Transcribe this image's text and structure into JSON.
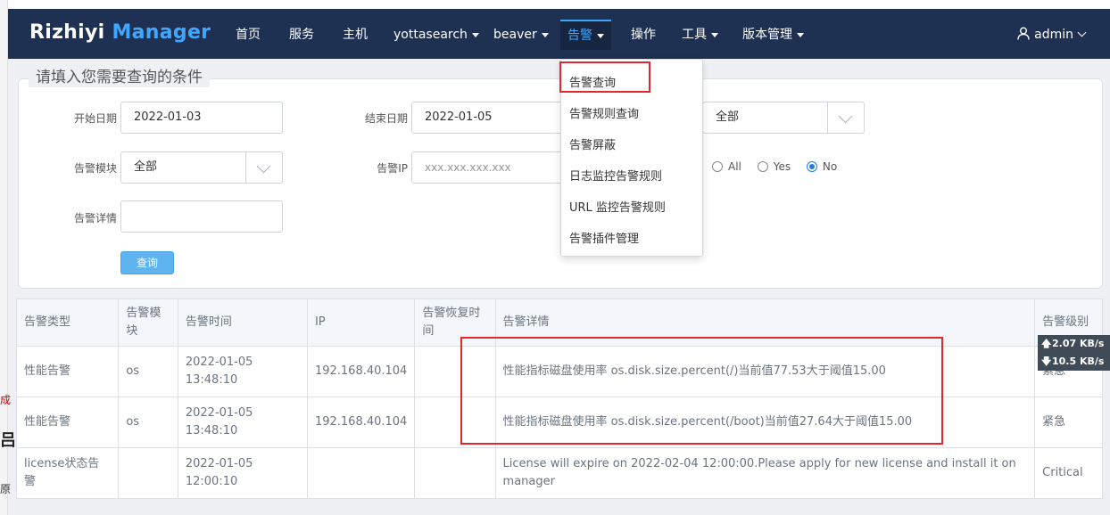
{
  "brand": {
    "part1": "Rizhiyi",
    "part2": "Manager"
  },
  "nav": {
    "items": [
      {
        "label": "首页"
      },
      {
        "label": "服务"
      },
      {
        "label": "主机"
      },
      {
        "label": "yottasearch"
      },
      {
        "label": "beaver"
      },
      {
        "label": "告警"
      },
      {
        "label": "操作"
      },
      {
        "label": "工具"
      },
      {
        "label": "版本管理"
      }
    ],
    "user": "admin"
  },
  "dropdown": {
    "items": [
      "告警查询",
      "告警规则查询",
      "告警屏蔽",
      "日志监控告警规则",
      "URL 监控告警规则",
      "告警插件管理"
    ]
  },
  "query": {
    "legend": "请填入您需要查询的条件",
    "start_label": "开始日期",
    "start_value": "2022-01-03",
    "end_label": "结束日期",
    "end_value": "2022-01-05",
    "level_value": "全部",
    "module_label": "告警模块",
    "module_value": "全部",
    "ip_label": "告警IP",
    "ip_placeholder": "xxx.xxx.xxx.xxx",
    "radio": [
      "All",
      "Yes",
      "No"
    ],
    "radio_selected": "No",
    "detail_label": "告警详情",
    "detail_value": "",
    "submit": "查询"
  },
  "table": {
    "headers": [
      "告警类型",
      "告警模块",
      "告警时间",
      "IP",
      "告警恢复时间",
      "告警详情",
      "告警级别"
    ],
    "rows": [
      [
        "性能告警",
        "os",
        "2022-01-05 13:48:10",
        "192.168.40.104",
        "",
        "性能指标磁盘使用率 os.disk.size.percent(/)当前值77.53大于阈值15.00",
        "紧急"
      ],
      [
        "性能告警",
        "os",
        "2022-01-05 13:48:10",
        "192.168.40.104",
        "",
        "性能指标磁盘使用率 os.disk.size.percent(/boot)当前值27.64大于阈值15.00",
        "紧急"
      ],
      [
        "license状态告警",
        "",
        "2022-01-05 12:00:10",
        "",
        "",
        "License will expire on 2022-02-04 12:00:00.Please apply for new license and install it on manager",
        "Critical"
      ]
    ]
  },
  "speed": {
    "up": "2.07 KB/s",
    "down": "10.5 KB/s"
  },
  "background": {
    "g1": "成",
    "g2": "吕",
    "g3": "原"
  },
  "colors": {
    "nav_bg": "#1f3152",
    "accent": "#3fa7ff",
    "highlight": "#e0282e",
    "button": "#5fb4f0"
  }
}
